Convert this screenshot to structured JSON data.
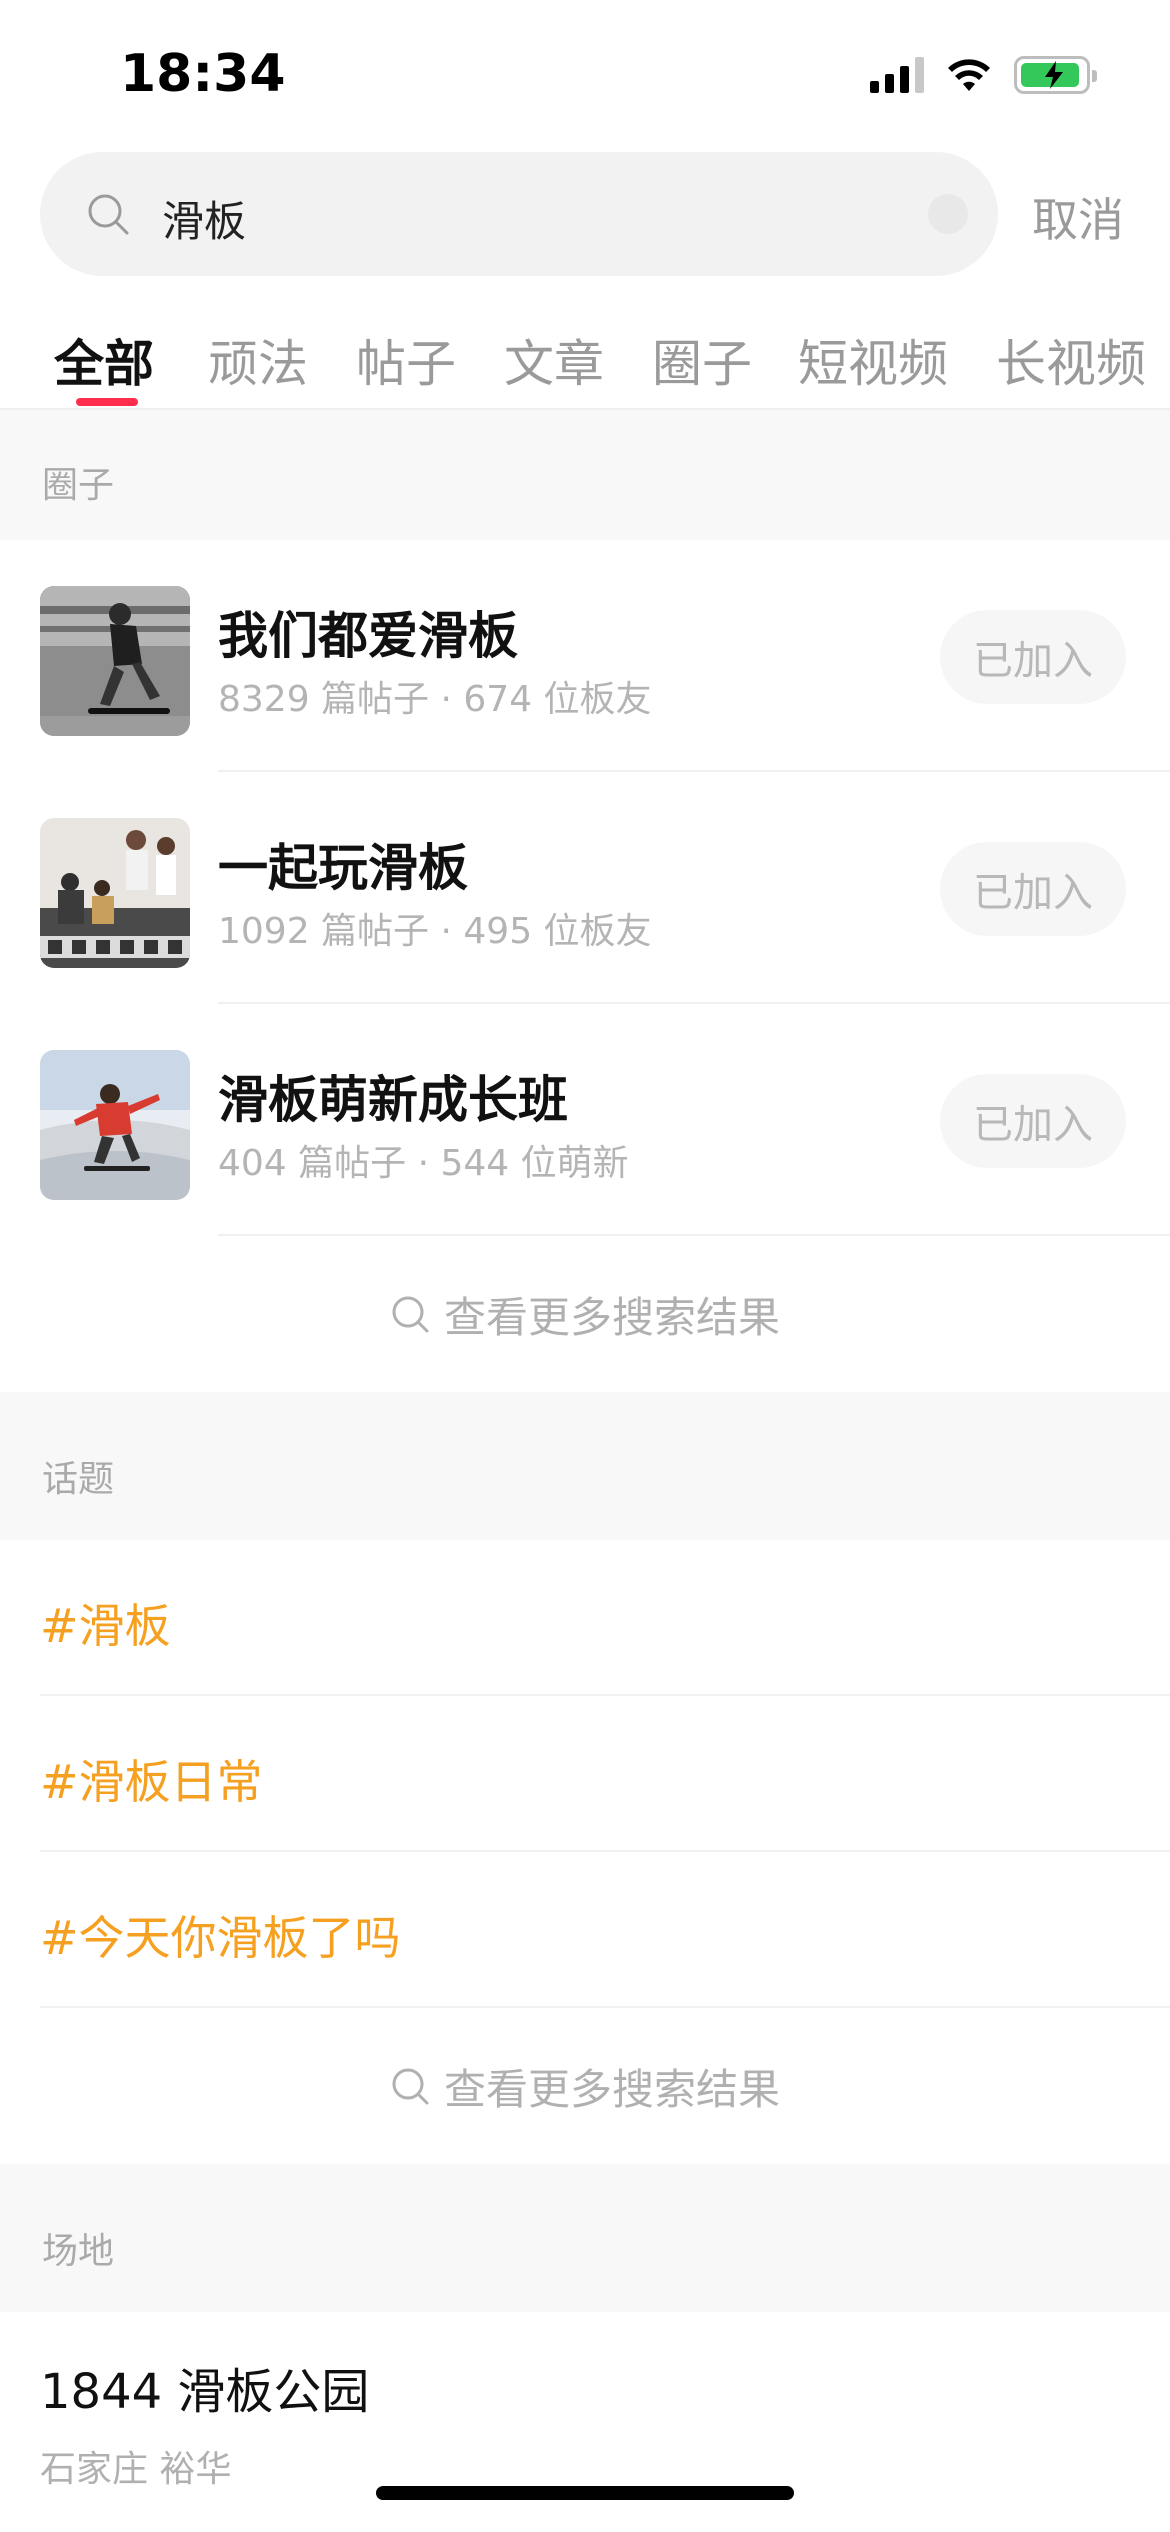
{
  "status_bar": {
    "time": "18:34",
    "battery_color": "#34c759"
  },
  "search": {
    "query": "滑板",
    "cancel_label": "取消"
  },
  "tabs": [
    {
      "label": "全部",
      "active": true
    },
    {
      "label": "顽法"
    },
    {
      "label": "帖子"
    },
    {
      "label": "文章"
    },
    {
      "label": "圈子"
    },
    {
      "label": "短视频"
    },
    {
      "label": "长视频"
    }
  ],
  "accent_color": "#ff2e4d",
  "topic_color": "#f5a020",
  "circles_section": {
    "title": "圈子",
    "items": [
      {
        "name": "我们都爱滑板",
        "meta": "8329 篇帖子 · 674 位板友",
        "button": "已加入"
      },
      {
        "name": "一起玩滑板",
        "meta": "1092 篇帖子 · 495 位板友",
        "button": "已加入"
      },
      {
        "name": "滑板萌新成长班",
        "meta": "404 篇帖子 · 544 位萌新",
        "button": "已加入"
      }
    ],
    "more_label": "查看更多搜索结果"
  },
  "topics_section": {
    "title": "话题",
    "items": [
      "#滑板",
      "#滑板日常",
      "#今天你滑板了吗"
    ],
    "more_label": "查看更多搜索结果"
  },
  "venues_section": {
    "title": "场地",
    "items": [
      {
        "name": "1844 滑板公园",
        "location": "石家庄 裕华"
      }
    ]
  }
}
